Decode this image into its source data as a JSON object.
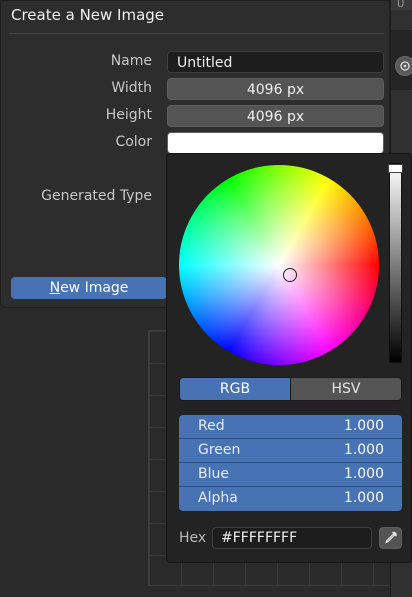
{
  "dialog": {
    "title": "Create a New Image",
    "fields": {
      "name_label": "Name",
      "name_value": "Untitled",
      "width_label": "Width",
      "width_value": "4096 px",
      "height_label": "Height",
      "height_value": "4096 px",
      "color_label": "Color",
      "generated_type_label": "Generated Type"
    },
    "new_image_button": {
      "mnemonic": "N",
      "rest": "ew Image"
    }
  },
  "right_strip": {
    "top_tab": "U"
  },
  "color_picker": {
    "color_value": "#FFFFFF",
    "modes": [
      "RGB",
      "HSV"
    ],
    "active_mode": "RGB",
    "channels": [
      {
        "label": "Red",
        "value": "1.000"
      },
      {
        "label": "Green",
        "value": "1.000"
      },
      {
        "label": "Blue",
        "value": "1.000"
      },
      {
        "label": "Alpha",
        "value": "1.000"
      }
    ],
    "hex_label": "Hex",
    "hex_value": "#FFFFFFFF",
    "value_level": 1.0
  },
  "colors": {
    "accent": "#4772b3",
    "panel": "#2d2d2d",
    "popover": "#232323"
  },
  "icons": {
    "eyedropper": "eyedropper-icon",
    "right_circle": "refresh-icon"
  }
}
